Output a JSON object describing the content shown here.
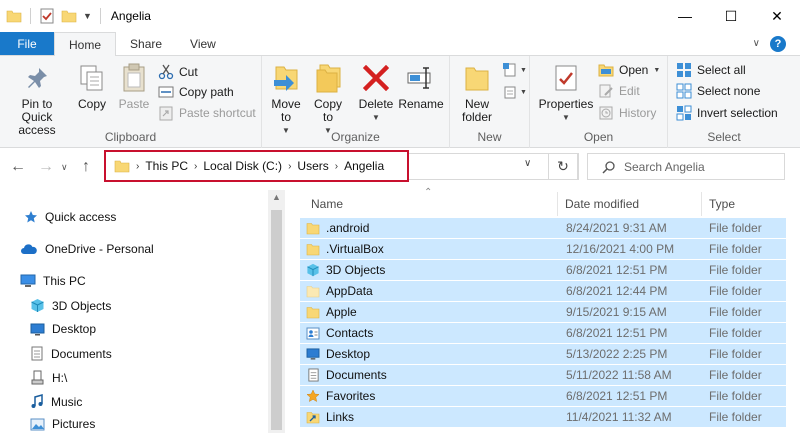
{
  "window": {
    "title": "Angelia",
    "controls": {
      "minimize": "—",
      "maximize": "☐",
      "close": "✕"
    }
  },
  "tabs": [
    {
      "label": "File"
    },
    {
      "label": "Home"
    },
    {
      "label": "Share"
    },
    {
      "label": "View"
    }
  ],
  "ribbon": {
    "clipboard": {
      "label": "Clipboard",
      "pin": "Pin to Quick access",
      "copy": "Copy",
      "paste": "Paste",
      "cut": "Cut",
      "copy_path": "Copy path",
      "paste_shortcut": "Paste shortcut"
    },
    "organize": {
      "label": "Organize",
      "move_to": "Move to",
      "copy_to": "Copy to",
      "delete": "Delete",
      "rename": "Rename"
    },
    "new": {
      "label": "New",
      "new_folder": "New folder"
    },
    "open": {
      "label": "Open",
      "properties": "Properties",
      "open": "Open",
      "edit": "Edit",
      "history": "History"
    },
    "select": {
      "label": "Select",
      "select_all": "Select all",
      "select_none": "Select none",
      "invert": "Invert selection"
    }
  },
  "address": {
    "crumbs": [
      "This PC",
      "Local Disk (C:)",
      "Users",
      "Angelia"
    ]
  },
  "search": {
    "placeholder": "Search Angelia"
  },
  "nav": {
    "quick_access": "Quick access",
    "onedrive": "OneDrive - Personal",
    "this_pc": "This PC",
    "items": [
      "3D Objects",
      "Desktop",
      "Documents",
      "H:\\",
      "Music",
      "Pictures"
    ]
  },
  "columns": {
    "name": "Name",
    "date": "Date modified",
    "type": "Type"
  },
  "files": [
    {
      "name": ".android",
      "date": "8/24/2021 9:31 AM",
      "type": "File folder",
      "icon": "folder-icon"
    },
    {
      "name": ".VirtualBox",
      "date": "12/16/2021 4:00 PM",
      "type": "File folder",
      "icon": "folder-icon"
    },
    {
      "name": "3D Objects",
      "date": "6/8/2021 12:51 PM",
      "type": "File folder",
      "icon": "3d-objects-icon"
    },
    {
      "name": "AppData",
      "date": "6/8/2021 12:44 PM",
      "type": "File folder",
      "icon": "folder-hidden-icon"
    },
    {
      "name": "Apple",
      "date": "9/15/2021 9:15 AM",
      "type": "File folder",
      "icon": "folder-icon"
    },
    {
      "name": "Contacts",
      "date": "6/8/2021 12:51 PM",
      "type": "File folder",
      "icon": "contacts-icon"
    },
    {
      "name": "Desktop",
      "date": "5/13/2022 2:25 PM",
      "type": "File folder",
      "icon": "desktop-icon"
    },
    {
      "name": "Documents",
      "date": "5/11/2022 11:58 AM",
      "type": "File folder",
      "icon": "documents-icon"
    },
    {
      "name": "Favorites",
      "date": "6/8/2021 12:51 PM",
      "type": "File folder",
      "icon": "favorites-icon"
    },
    {
      "name": "Links",
      "date": "11/4/2021 11:32 AM",
      "type": "File folder",
      "icon": "links-icon"
    }
  ]
}
